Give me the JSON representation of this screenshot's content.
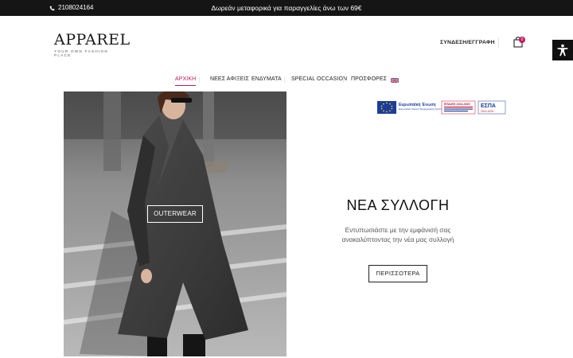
{
  "topbar": {
    "phone": "2108024164",
    "promo": "Δωρεάν μεταφορικά για παραγγελίες άνω των 69€"
  },
  "logo": {
    "word": "APPAREL",
    "tagline": "YOUR OWN FASHION PLACE"
  },
  "header": {
    "login_label": "ΣΥΝΔΕΣΗ/ΕΓΓΡΑΦΗ",
    "cart_count": "0"
  },
  "nav": {
    "items": [
      {
        "label": "ΑΡΧΙΚΗ"
      },
      {
        "label": "ΝΕΕΣ ΑΦΙΞΕΙΣ"
      },
      {
        "label": "ΕΝΔΥΜΑΤΑ"
      },
      {
        "label": "SPECIAL OCCASION"
      },
      {
        "label": "ΠΡΟΣΦΟΡΕΣ"
      }
    ]
  },
  "hero": {
    "category_button": "OUTERWEAR"
  },
  "espa": {
    "eu_title": "Ευρωπαϊκή Ένωση",
    "eu_subtitle": "Ευρωπαϊκό Ταμείο Περιφερειακής Ανάπτυξης",
    "epanek": "ΕΠΑνΕΚ 2014-2020",
    "espa_title": "ΕΣΠΑ",
    "espa_years": "2014-2020"
  },
  "collection": {
    "title": "ΝΕΑ ΣΥΛΛΟΓΗ",
    "description": "Εντυπωσιάστε με την εμφάνισή σας ανακαλύπτοντας την νέα μας συλλογή",
    "button": "ΠΕΡΙΣΣΟΤΕΡΑ"
  }
}
